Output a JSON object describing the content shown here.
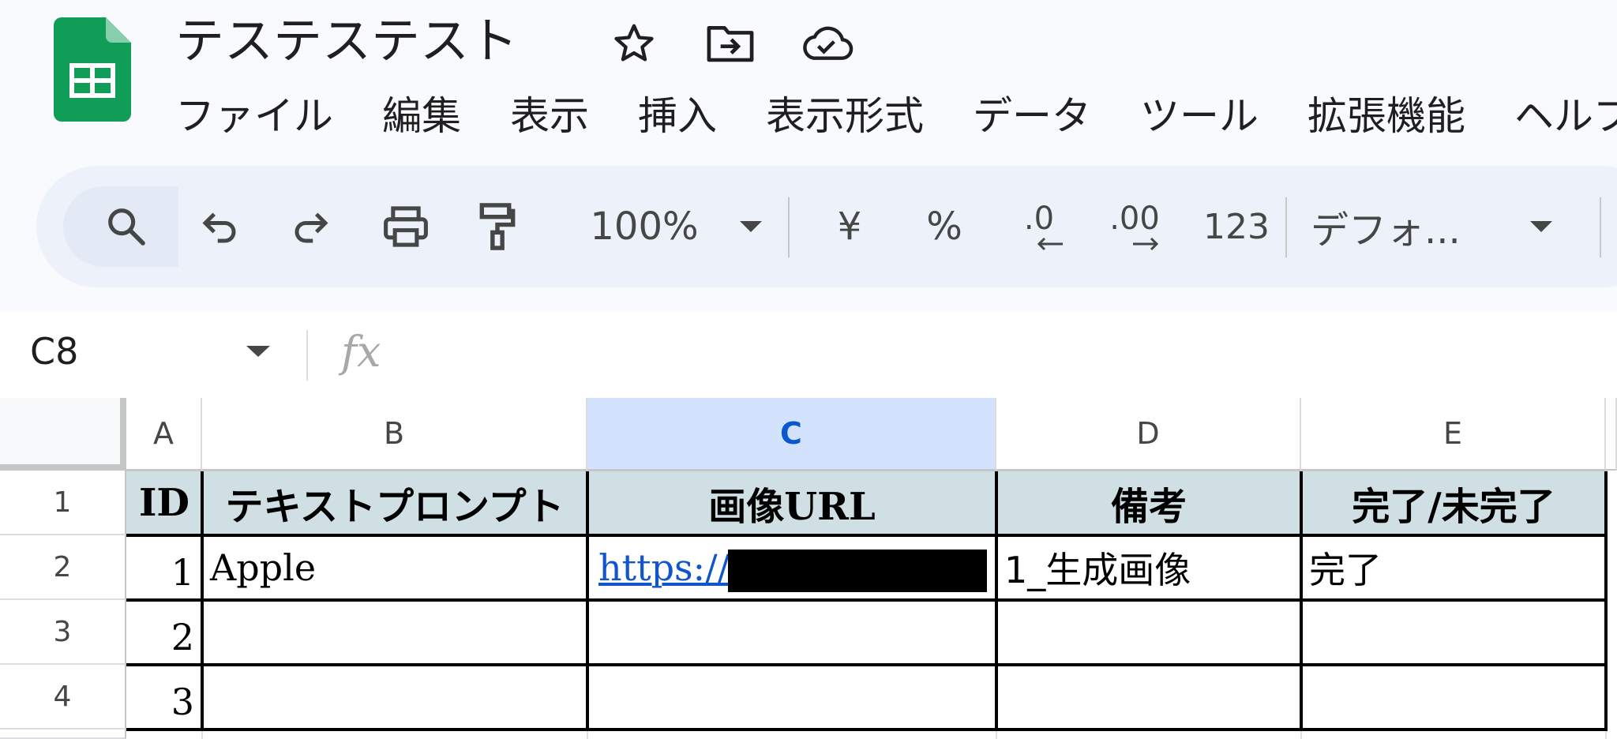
{
  "app": {
    "doc_title": "テステステスト",
    "brand_color": "#0f9d58"
  },
  "menu": [
    "ファイル",
    "編集",
    "表示",
    "挿入",
    "表示形式",
    "データ",
    "ツール",
    "拡張機能",
    "ヘルプ"
  ],
  "toolbar": {
    "zoom": "100%",
    "currency": "¥",
    "percent": "%",
    "decrease_decimal": ".0",
    "increase_decimal": ".00",
    "number_format": "123",
    "font": "デフォ..."
  },
  "formula_bar": {
    "name_box": "C8",
    "fx_label": "fx",
    "value": ""
  },
  "sheet": {
    "columns": [
      "A",
      "B",
      "C",
      "D",
      "E"
    ],
    "rows": [
      "1",
      "2",
      "3",
      "4"
    ],
    "header": [
      "ID",
      "テキストプロンプト",
      "画像URL",
      "備考",
      "完了/未完了"
    ],
    "data": [
      {
        "id": "1",
        "prompt": "Apple",
        "url": "https://",
        "note": "1_生成画像",
        "status": "完了"
      },
      {
        "id": "2",
        "prompt": "",
        "url": "",
        "note": "",
        "status": ""
      },
      {
        "id": "3",
        "prompt": "",
        "url": "",
        "note": "",
        "status": ""
      }
    ],
    "selected_column": "C",
    "header_fill": "#d0dfe3",
    "link_color": "#1155cc"
  }
}
